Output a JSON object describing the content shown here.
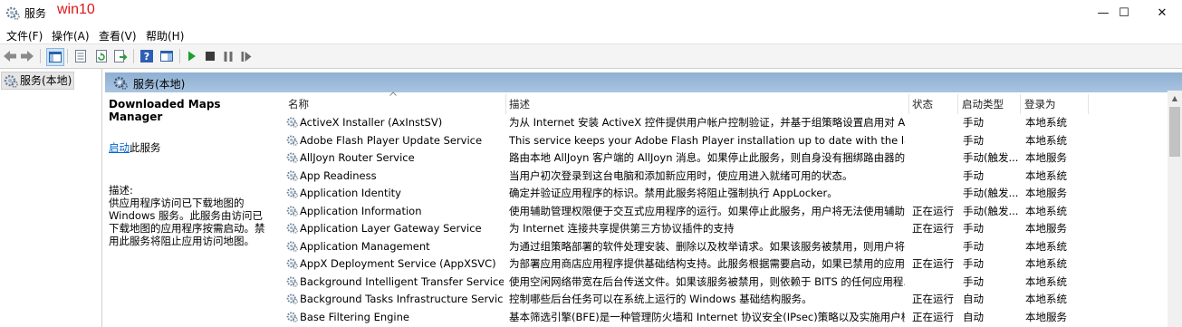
{
  "window": {
    "title": "服务",
    "tag": "win10",
    "min": "—",
    "max": "☐",
    "close": "✕"
  },
  "menu": [
    "文件(F)",
    "操作(A)",
    "查看(V)",
    "帮助(H)"
  ],
  "tree": {
    "item": "服务(本地)"
  },
  "pane": {
    "title": "服务(本地)"
  },
  "detail": {
    "name": "Downloaded Maps Manager",
    "start_link": "启动",
    "start_suffix": "此服务",
    "desc_label": "描述:",
    "desc": "供应用程序访问已下载地图的 Windows 服务。此服务由访问已下载地图的应用程序按需启动。禁用此服务将阻止应用访问地图。"
  },
  "columns": {
    "name": "名称",
    "desc": "描述",
    "status": "状态",
    "startup": "启动类型",
    "logon": "登录为"
  },
  "services": [
    {
      "name": "ActiveX Installer (AxInstSV)",
      "desc": "为从 Internet 安装 ActiveX 控件提供用户帐户控制验证，并基于组策略设置启用对 Act...",
      "status": "",
      "startup": "手动",
      "logon": "本地系统"
    },
    {
      "name": "Adobe Flash Player Update Service",
      "desc": "This service keeps your Adobe Flash Player installation up to date with the lates...",
      "status": "",
      "startup": "手动",
      "logon": "本地系统"
    },
    {
      "name": "AllJoyn Router Service",
      "desc": "路由本地 AllJoyn 客户端的 AllJoyn 消息。如果停止此服务，则自身没有捆绑路由器的 ...",
      "status": "",
      "startup": "手动(触发...",
      "logon": "本地服务"
    },
    {
      "name": "App Readiness",
      "desc": "当用户初次登录到这台电脑和添加新应用时，使应用进入就绪可用的状态。",
      "status": "",
      "startup": "手动",
      "logon": "本地系统"
    },
    {
      "name": "Application Identity",
      "desc": "确定并验证应用程序的标识。禁用此服务将阻止强制执行 AppLocker。",
      "status": "",
      "startup": "手动(触发...",
      "logon": "本地服务"
    },
    {
      "name": "Application Information",
      "desc": "使用辅助管理权限便于交互式应用程序的运行。如果停止此服务，用户将无法使用辅助...",
      "status": "正在运行",
      "startup": "手动(触发...",
      "logon": "本地系统"
    },
    {
      "name": "Application Layer Gateway Service",
      "desc": "为 Internet 连接共享提供第三方协议插件的支持",
      "status": "正在运行",
      "startup": "手动",
      "logon": "本地服务"
    },
    {
      "name": "Application Management",
      "desc": "为通过组策略部署的软件处理安装、删除以及枚举请求。如果该服务被禁用，则用户将...",
      "status": "",
      "startup": "手动",
      "logon": "本地系统"
    },
    {
      "name": "AppX Deployment Service (AppXSVC)",
      "desc": "为部署应用商店应用程序提供基础结构支持。此服务根据需要启动，如果已禁用的应用...",
      "status": "正在运行",
      "startup": "手动",
      "logon": "本地系统"
    },
    {
      "name": "Background Intelligent Transfer Service",
      "desc": "使用空闲网络带宽在后台传送文件。如果该服务被禁用，则依赖于 BITS 的任何应用程...",
      "status": "",
      "startup": "手动",
      "logon": "本地系统"
    },
    {
      "name": "Background Tasks Infrastructure Service",
      "desc": "控制哪些后台任务可以在系统上运行的 Windows 基础结构服务。",
      "status": "正在运行",
      "startup": "自动",
      "logon": "本地系统"
    },
    {
      "name": "Base Filtering Engine",
      "desc": "基本筛选引擎(BFE)是一种管理防火墙和 Internet 协议安全(IPsec)策略以及实施用户模...",
      "status": "正在运行",
      "startup": "自动",
      "logon": "本地服务"
    }
  ]
}
